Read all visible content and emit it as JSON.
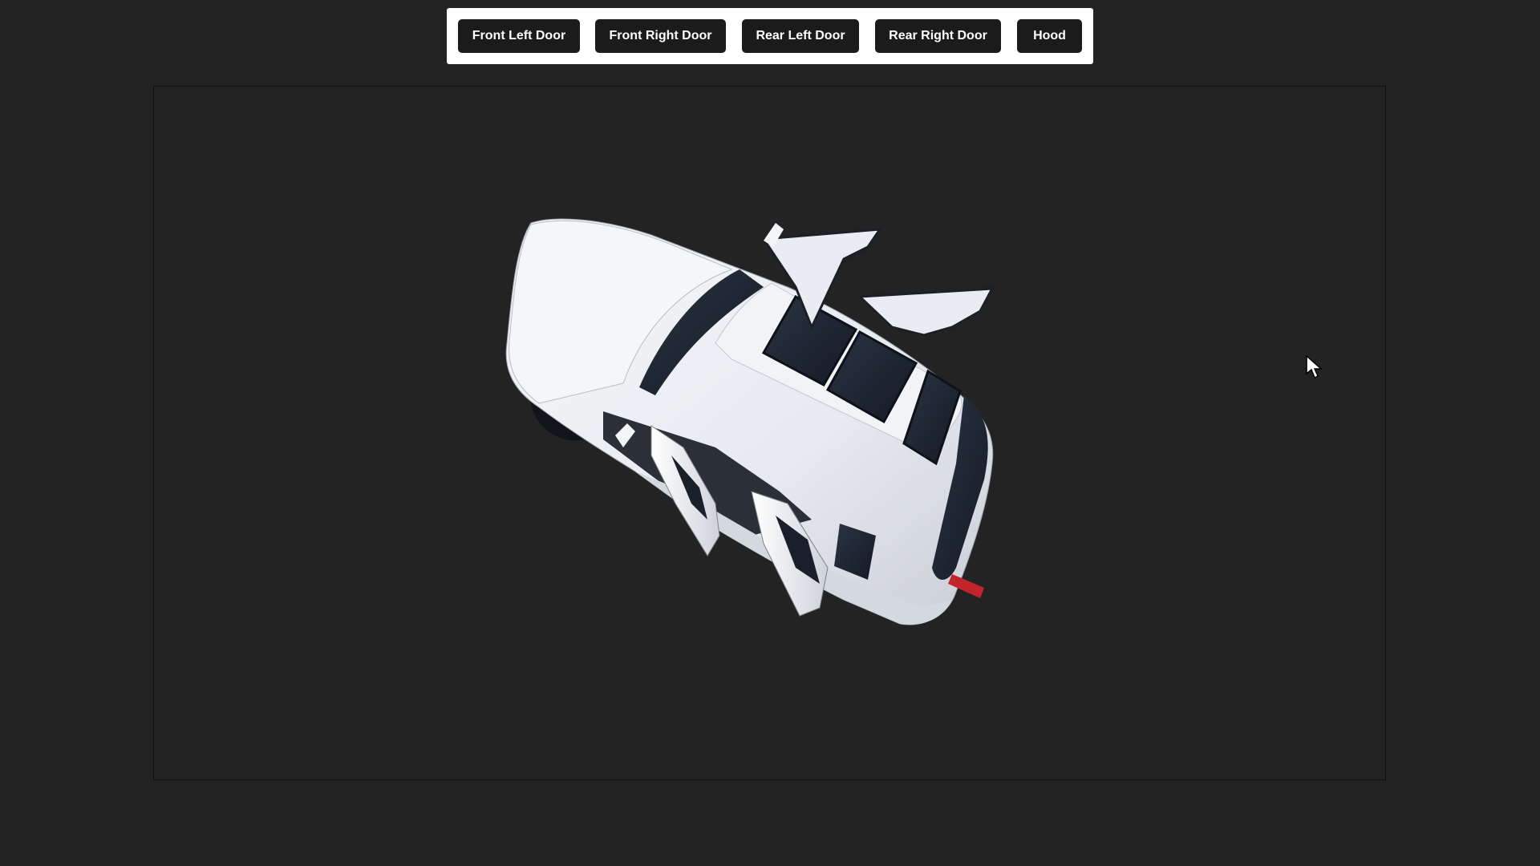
{
  "toolbar": {
    "buttons": [
      {
        "id": "front-left-door",
        "label": "Front Left Door"
      },
      {
        "id": "front-right-door",
        "label": "Front Right Door"
      },
      {
        "id": "rear-left-door",
        "label": "Rear Left Door"
      },
      {
        "id": "rear-right-door",
        "label": "Rear Right Door"
      },
      {
        "id": "hood",
        "label": "Hood"
      }
    ]
  },
  "viewer": {
    "model": "white-suv-3d-model",
    "open_parts": [
      "front-left-door",
      "front-right-door",
      "rear-left-door",
      "rear-right-door"
    ]
  },
  "colors": {
    "background": "#232323",
    "toolbar_bg": "#ffffff",
    "button_bg": "#1b1b1b",
    "button_text": "#ffffff",
    "car_body": "#eef0f4",
    "glass": "#1d2431"
  },
  "icons": {
    "cursor": "mouse-pointer-icon"
  }
}
